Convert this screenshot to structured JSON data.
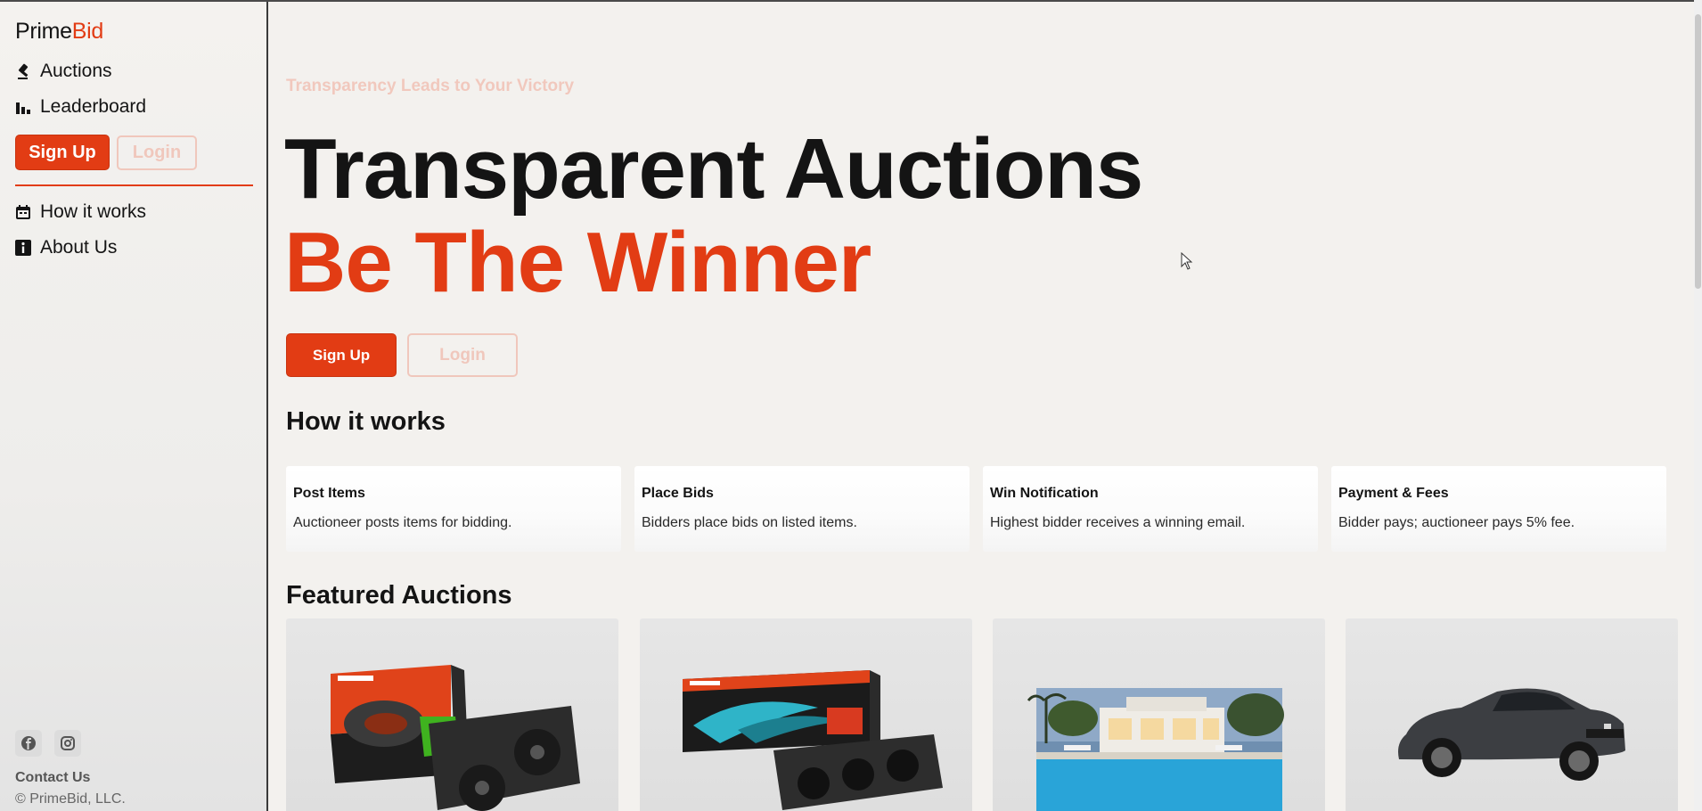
{
  "sidebar": {
    "brand_part1": "Prime",
    "brand_part2": "Bid",
    "nav": {
      "auctions": "Auctions",
      "leaderboard": "Leaderboard",
      "how_it_works": "How it works",
      "about_us": "About Us"
    },
    "signup_label": "Sign Up",
    "login_label": "Login",
    "contact": "Contact Us",
    "copyright": "© PrimeBid, LLC.",
    "icons": [
      "gavel-icon",
      "bar-chart-icon",
      "calendar-icon",
      "info-icon",
      "facebook-icon",
      "instagram-icon"
    ]
  },
  "hero": {
    "tagline": "Transparency Leads to Your Victory",
    "headline": "Transparent Auctions",
    "subheadline": "Be The Winner",
    "signup_label": "Sign Up",
    "login_label": "Login"
  },
  "how_it_works": {
    "title": "How it works",
    "steps": [
      {
        "title": "Post Items",
        "desc": "Auctioneer posts items for bidding."
      },
      {
        "title": "Place Bids",
        "desc": "Bidders place bids on listed items."
      },
      {
        "title": "Win Notification",
        "desc": "Highest bidder receives a winning email."
      },
      {
        "title": "Payment & Fees",
        "desc": "Bidder pays; auctioneer pays 5% fee."
      }
    ]
  },
  "featured": {
    "title": "Featured Auctions",
    "items": [
      {
        "image": "gigabyte-geforce-gtx-graphics-card"
      },
      {
        "image": "gigabyte-radeon-graphics-card"
      },
      {
        "image": "luxury-villa-with-pool"
      },
      {
        "image": "classic-muscle-car"
      }
    ]
  },
  "colors": {
    "accent": "#e23c14",
    "text": "#141414",
    "muted_accent": "#f0c7bc",
    "background": "#f3f1ee"
  }
}
